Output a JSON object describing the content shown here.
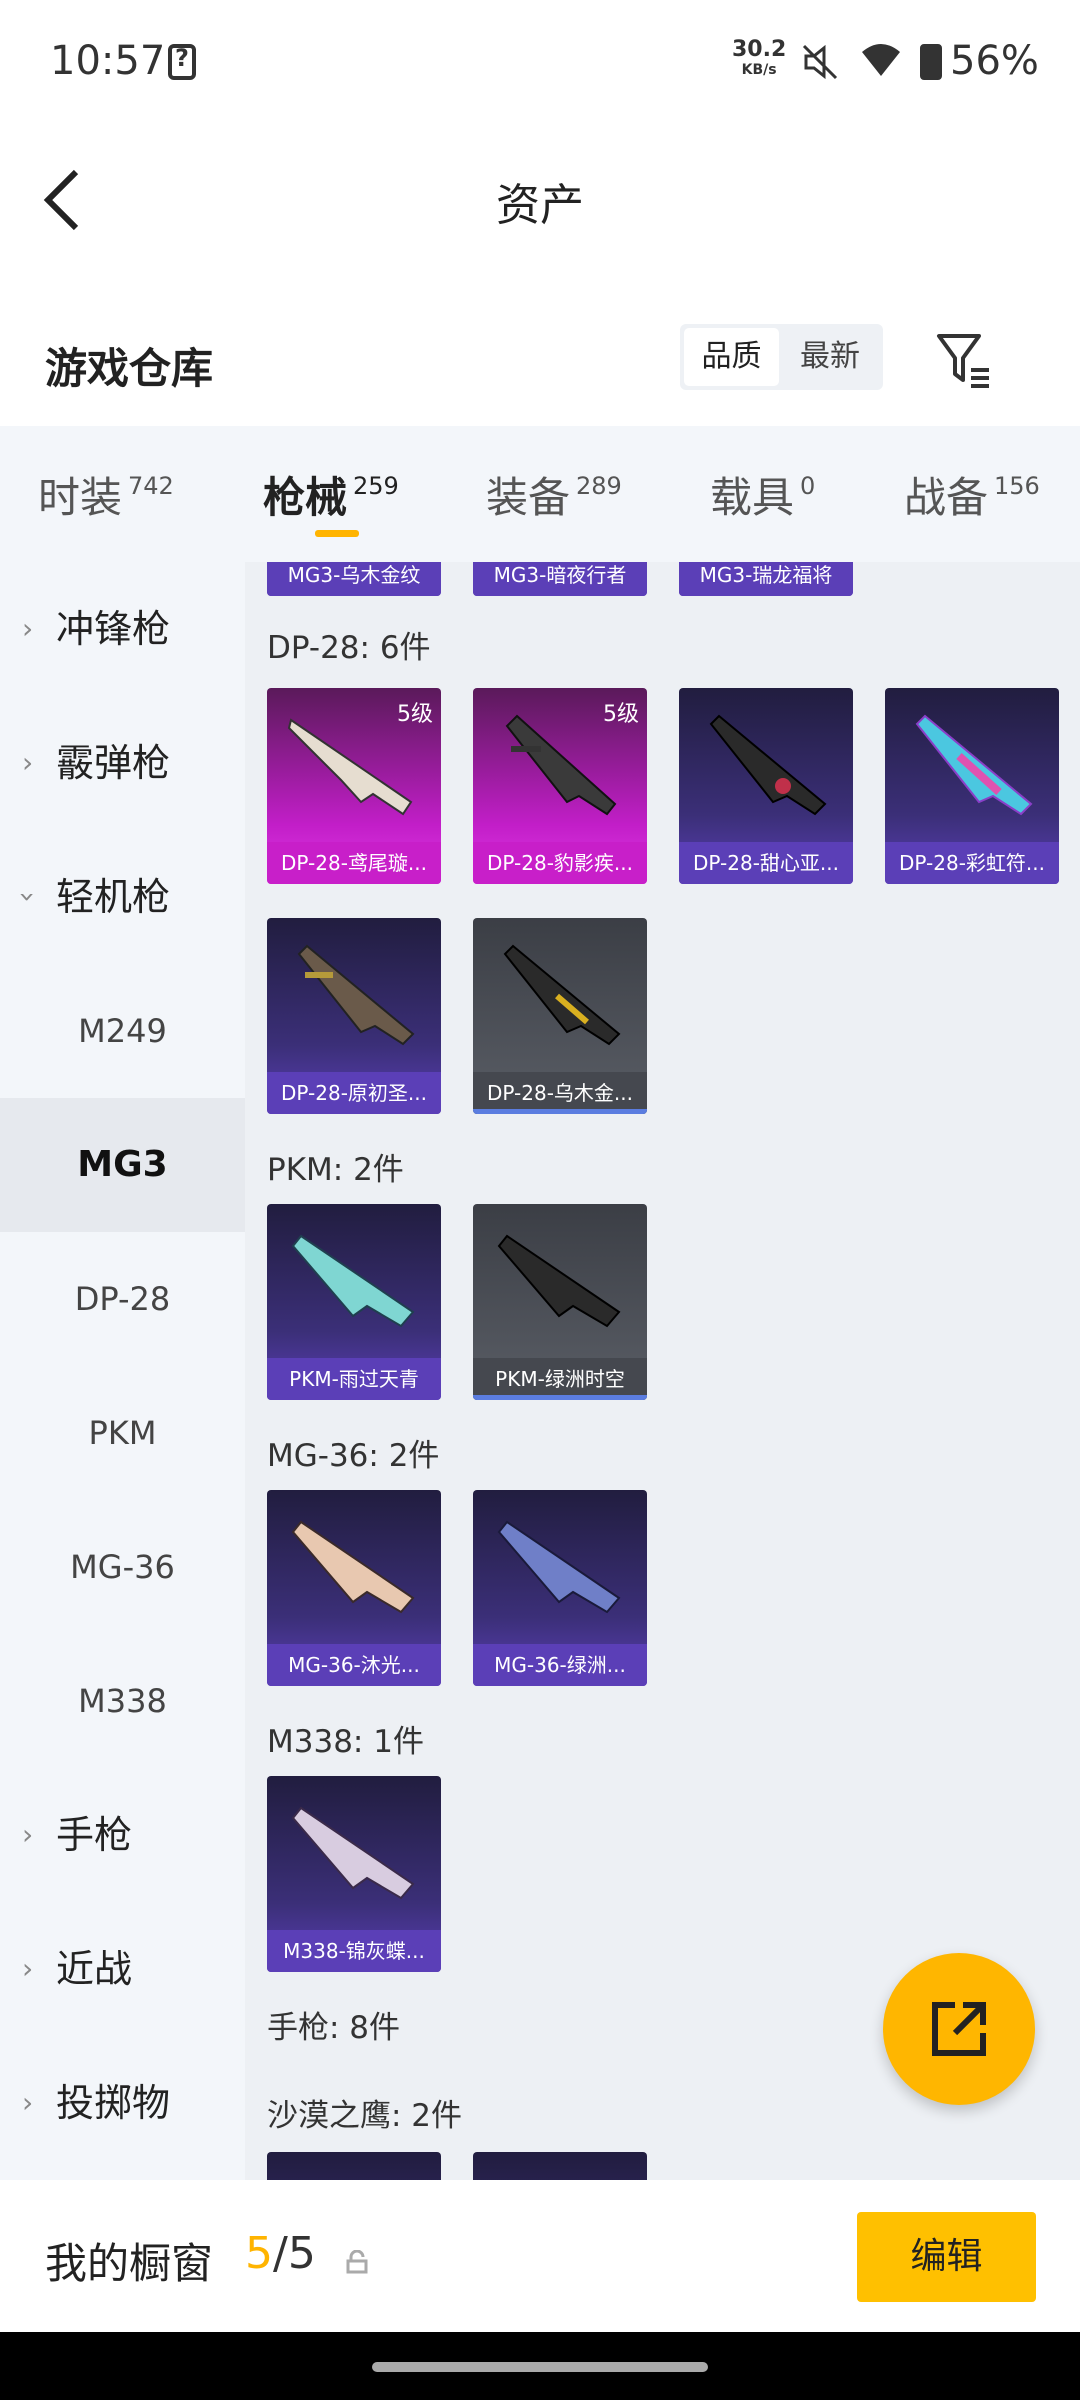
{
  "status": {
    "time": "10:57",
    "speed_value": "30.2",
    "speed_unit": "KB/s",
    "battery": "56%"
  },
  "header": {
    "title": "资产"
  },
  "warehouse": {
    "title": "游戏仓库",
    "sort_quality": "品质",
    "sort_latest": "最新"
  },
  "tabs": [
    {
      "label": "时装",
      "count": "742"
    },
    {
      "label": "枪械",
      "count": "259"
    },
    {
      "label": "装备",
      "count": "289"
    },
    {
      "label": "载具",
      "count": "0"
    },
    {
      "label": "战备",
      "count": "156"
    }
  ],
  "sidebar": {
    "cat_smg": "冲锋枪",
    "cat_shotgun": "霰弹枪",
    "cat_lmg": "轻机枪",
    "subs": [
      "M249",
      "MG3",
      "DP-28",
      "PKM",
      "MG-36",
      "M338"
    ],
    "cat_pistol": "手枪",
    "cat_melee": "近战",
    "cat_throw": "投掷物"
  },
  "content": {
    "top_cards": [
      "MG3-乌木金纹",
      "MG3-暗夜行者",
      "MG3-瑞龙福将"
    ],
    "groups": {
      "dp28": {
        "title": "DP-28: 6件",
        "cards": [
          "DP-28-鸢尾璇...",
          "DP-28-豹影疾...",
          "DP-28-甜心亚...",
          "DP-28-彩虹符...",
          "DP-28-原初圣...",
          "DP-28-乌木金..."
        ],
        "level": "5级"
      },
      "pkm": {
        "title": "PKM: 2件",
        "cards": [
          "PKM-雨过天青",
          "PKM-绿洲时空"
        ]
      },
      "mg36": {
        "title": "MG-36: 2件",
        "cards": [
          "MG-36-沐光...",
          "MG-36-绿洲..."
        ]
      },
      "m338": {
        "title": "M338: 1件",
        "cards": [
          "M338-锦灰蝶..."
        ]
      },
      "pistol": {
        "title": "手枪: 8件"
      },
      "deagle": {
        "title": "沙漠之鹰: 2件"
      }
    }
  },
  "bottom": {
    "label": "我的橱窗",
    "count_current": "5",
    "count_sep": "/",
    "count_total": "5",
    "edit": "编辑"
  },
  "colors": {
    "accent": "#ffb400",
    "pink_card": "#c81fc9",
    "purple_card": "#5b3fb7",
    "grey_card": "#45484f"
  }
}
